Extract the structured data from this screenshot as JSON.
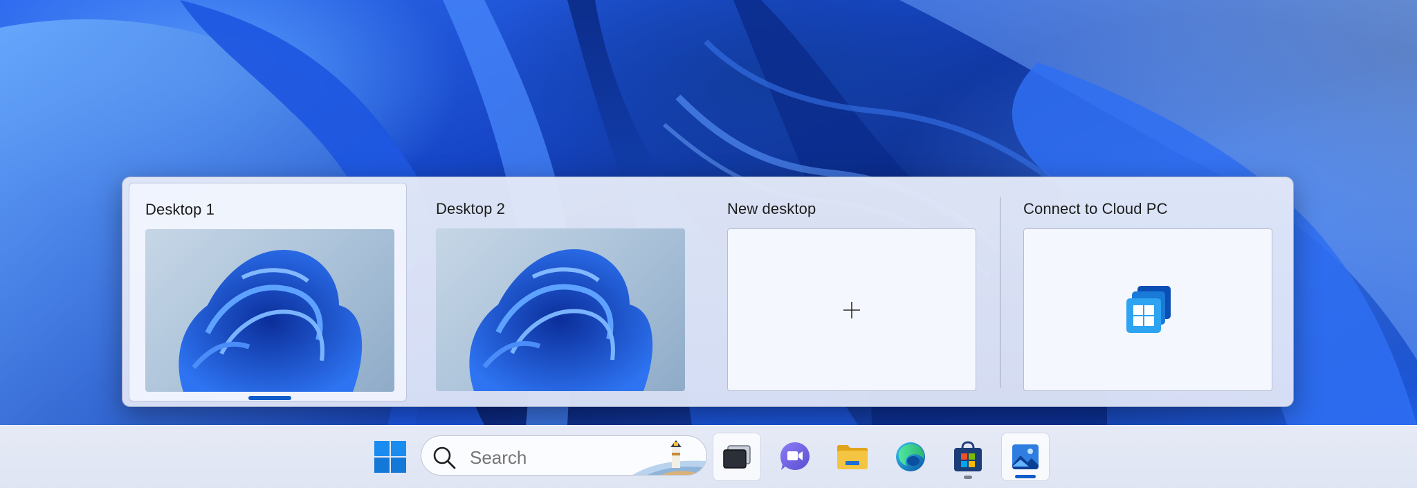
{
  "flyout": {
    "desktops": [
      {
        "label": "Desktop 1",
        "selected": true
      },
      {
        "label": "Desktop 2",
        "selected": false
      }
    ],
    "new_desktop_label": "New desktop",
    "cloud_pc_label": "Connect to Cloud PC"
  },
  "taskbar": {
    "start_icon": "windows-logo-icon",
    "search": {
      "placeholder": "Search",
      "highlight_icon": "lighthouse-icon"
    },
    "apps": [
      {
        "name": "task-view",
        "icon": "task-view-icon",
        "state": "open"
      },
      {
        "name": "teams-meet",
        "icon": "video-camera-icon",
        "state": "none"
      },
      {
        "name": "file-explorer",
        "icon": "folder-icon",
        "state": "none"
      },
      {
        "name": "edge",
        "icon": "edge-icon",
        "state": "none"
      },
      {
        "name": "microsoft-store",
        "icon": "store-bag-icon",
        "state": "running"
      },
      {
        "name": "photos",
        "icon": "photos-icon",
        "state": "active"
      }
    ]
  },
  "colors": {
    "accent": "#0f5bcc",
    "wallpaper_blue": "#1646c7"
  }
}
